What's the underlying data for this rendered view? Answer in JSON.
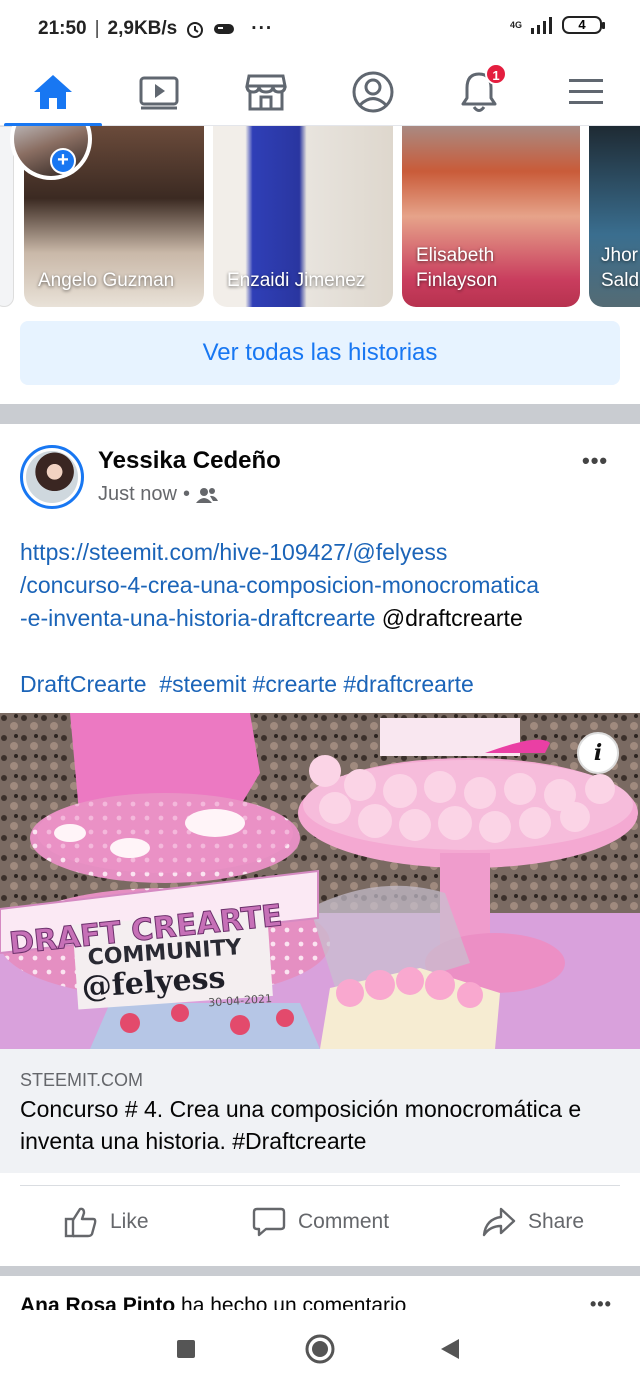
{
  "status_bar": {
    "time": "21:50",
    "speed": "2,9KB/s",
    "more": "···",
    "network": "4G",
    "battery": "4"
  },
  "nav": {
    "tabs": [
      {
        "name": "home",
        "active": true
      },
      {
        "name": "watch",
        "active": false
      },
      {
        "name": "marketplace",
        "active": false
      },
      {
        "name": "profile",
        "active": false
      },
      {
        "name": "notifications",
        "active": false,
        "badge": "1"
      },
      {
        "name": "menu",
        "active": false
      }
    ],
    "notification_badge": "1",
    "accent_color": "#1877f2"
  },
  "stories": {
    "items": [
      {
        "name": "Angelo Guzman"
      },
      {
        "name": "Enzaidi Jimenez"
      },
      {
        "name": "Elisabeth Finlayson"
      },
      {
        "name": "Jhor Sald"
      }
    ],
    "see_all_label": "Ver todas las historias"
  },
  "post": {
    "author": "Yessika Cedeño",
    "time": "Just now",
    "separator": "•",
    "link_line1": "https://steemit.com/hive-109427/@felyess",
    "link_line2": "/concurso-4-crea-una-composicion-monocromatica",
    "link_line3": "-e-inventa-una-historia-draftcrearte",
    "mention": " @draftcrearte",
    "tags": "DraftCrearte  #steemit #crearte #draftcrearte",
    "image_text": {
      "line1": "DRAFT CREARTE",
      "line2": "COMMUNITY",
      "line3": "@felyess",
      "line4": "30-04-2021"
    },
    "info_label": "i",
    "link_domain": "STEEMIT.COM",
    "link_title": "Concurso # 4. Crea una composición monocromática e inventa una historia. #Draftcrearte",
    "actions": {
      "like": "Like",
      "comment": "Comment",
      "share": "Share"
    }
  },
  "next_post": {
    "author": "Ana Rosa Pinto",
    "text": " ha hecho un comentario"
  },
  "more_icon": "•••"
}
